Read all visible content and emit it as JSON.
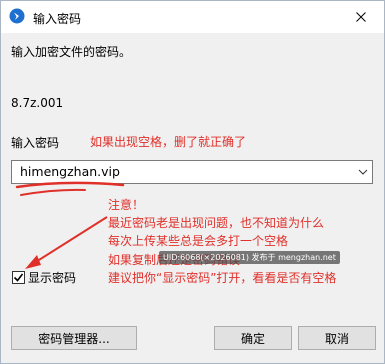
{
  "window": {
    "title": "输入密码"
  },
  "prompt": "输入加密文件的密码。",
  "filename": "8.7z.001",
  "password": {
    "label": "输入密码",
    "value": "himengzhan.vip"
  },
  "annotations": {
    "space_note": "如果出现空格，删了就正确了",
    "notice_lines": [
      "注意！",
      "最近密码老是出现问题，也不知道为什么",
      "每次上传某些总是会多打一个空格",
      "如果复制后还是密码错误",
      "建议把你“显示密码”打开，看看是否有空格"
    ],
    "color": "#e0302a"
  },
  "show_password": {
    "label": "显示密码",
    "checked": true
  },
  "watermark": "UID:6068(×2026081) 发布于 mengzhan.net",
  "buttons": {
    "manager": "密码管理器...",
    "ok": "确定",
    "cancel": "取消"
  }
}
